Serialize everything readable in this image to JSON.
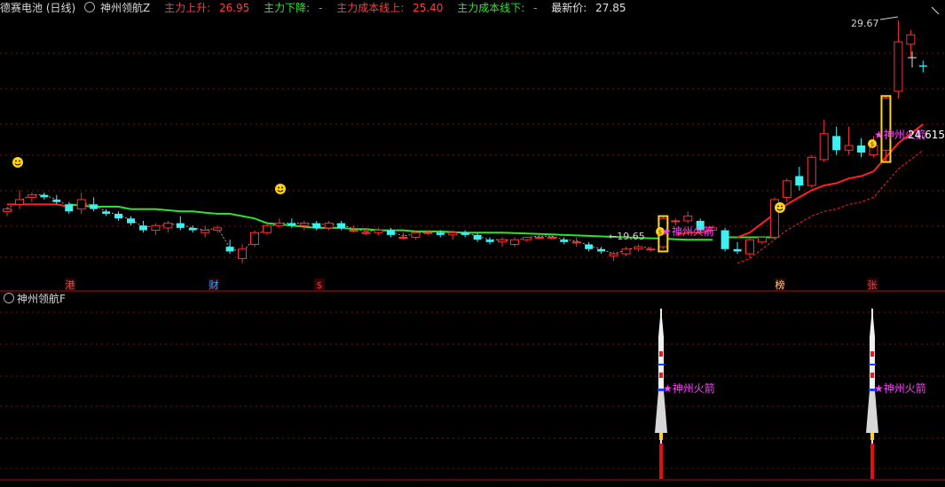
{
  "header": {
    "stock_name": "德赛电池 (日线)",
    "indicator_name": "神州领航Z",
    "up_label": "主力上升:",
    "up_value": "26.95",
    "down_label": "主力下降:",
    "down_value": "-",
    "cost_up_label": "主力成本线上:",
    "cost_up_value": "25.40",
    "cost_down_label": "主力成本线下:",
    "cost_down_value": "-",
    "latest_label": "最新价:",
    "latest_value": "27.85"
  },
  "sub_panel": {
    "title": "神州领航F"
  },
  "markers": {
    "high_label": "29.67",
    "low_label": "19.65",
    "signal_label": "神州火箭",
    "right_value": "24.615"
  },
  "event_tags": [
    "港",
    "财",
    "$",
    "榜",
    "张"
  ],
  "colors": {
    "up": "#ff3030",
    "down": "#3ef0f0",
    "support_green": "#2fe02f",
    "cost_red": "#ff2020",
    "signal_magenta": "#ff40ff",
    "gold": "#ffd21a",
    "background": "#000000"
  },
  "chart_data": {
    "type": "candlestick",
    "title": "德赛电池 (日线)",
    "candles": [
      [
        21.7,
        21.9,
        21.5,
        21.8
      ],
      [
        22.0,
        22.6,
        21.8,
        22.2
      ],
      [
        22.3,
        22.5,
        22.1,
        22.4
      ],
      [
        22.4,
        22.5,
        22.2,
        22.3
      ],
      [
        22.2,
        22.4,
        22.0,
        22.1
      ],
      [
        22.0,
        22.1,
        21.6,
        21.7
      ],
      [
        21.8,
        22.5,
        21.6,
        22.2
      ],
      [
        22.0,
        22.3,
        21.7,
        21.8
      ],
      [
        21.7,
        21.8,
        21.5,
        21.6
      ],
      [
        21.6,
        21.7,
        21.3,
        21.4
      ],
      [
        21.4,
        21.5,
        21.1,
        21.2
      ],
      [
        21.1,
        21.3,
        20.8,
        20.9
      ],
      [
        20.9,
        21.2,
        20.7,
        21.1
      ],
      [
        21.0,
        21.3,
        20.8,
        21.2
      ],
      [
        21.2,
        21.5,
        20.9,
        21.0
      ],
      [
        21.0,
        21.1,
        20.8,
        20.9
      ],
      [
        20.8,
        21.1,
        20.6,
        20.9
      ],
      [
        20.9,
        21.1,
        20.8,
        21.0
      ],
      [
        20.2,
        20.5,
        19.9,
        20.0
      ],
      [
        19.7,
        20.3,
        19.5,
        20.1
      ],
      [
        20.3,
        20.9,
        20.2,
        20.8
      ],
      [
        20.8,
        21.2,
        20.7,
        21.1
      ],
      [
        21.1,
        21.4,
        21.0,
        21.2
      ],
      [
        21.2,
        21.4,
        21.0,
        21.1
      ],
      [
        21.1,
        21.3,
        20.9,
        21.2
      ],
      [
        21.2,
        21.3,
        20.9,
        21.0
      ],
      [
        21.0,
        21.3,
        20.9,
        21.2
      ],
      [
        21.2,
        21.3,
        20.9,
        21.0
      ],
      [
        20.9,
        21.1,
        20.8,
        20.9
      ],
      [
        20.8,
        21.0,
        20.7,
        20.8
      ],
      [
        20.8,
        21.0,
        20.7,
        20.9
      ],
      [
        20.9,
        21.0,
        20.6,
        20.7
      ],
      [
        20.6,
        20.8,
        20.5,
        20.6
      ],
      [
        20.6,
        20.9,
        20.5,
        20.8
      ],
      [
        20.8,
        20.9,
        20.7,
        20.8
      ],
      [
        20.8,
        20.9,
        20.6,
        20.7
      ],
      [
        20.7,
        20.9,
        20.5,
        20.8
      ],
      [
        20.8,
        20.9,
        20.6,
        20.7
      ],
      [
        20.7,
        20.8,
        20.4,
        20.5
      ],
      [
        20.5,
        20.6,
        20.3,
        20.4
      ],
      [
        20.4,
        20.6,
        20.2,
        20.5
      ],
      [
        20.3,
        20.6,
        20.2,
        20.5
      ],
      [
        20.5,
        20.6,
        20.4,
        20.6
      ],
      [
        20.6,
        20.7,
        20.5,
        20.6
      ],
      [
        20.6,
        20.7,
        20.5,
        20.6
      ],
      [
        20.5,
        20.6,
        20.3,
        20.4
      ],
      [
        20.4,
        20.6,
        20.2,
        20.4
      ],
      [
        20.3,
        20.4,
        20.0,
        20.1
      ],
      [
        20.1,
        20.2,
        19.9,
        20.0
      ],
      [
        19.8,
        20.0,
        19.6,
        19.9
      ],
      [
        19.9,
        20.2,
        19.8,
        20.1
      ],
      [
        20.1,
        20.3,
        20.0,
        20.2
      ],
      [
        20.1,
        20.2,
        20.0,
        20.1
      ],
      [
        20.2,
        21.5,
        20.1,
        21.4
      ],
      [
        21.3,
        21.4,
        21.1,
        21.3
      ],
      [
        21.3,
        21.7,
        21.2,
        21.5
      ],
      [
        21.3,
        21.4,
        20.8,
        20.9
      ],
      [
        20.9,
        21.1,
        20.7,
        21.0
      ],
      [
        20.9,
        21.0,
        20.0,
        20.1
      ],
      [
        20.1,
        20.4,
        19.9,
        20.0
      ],
      [
        19.9,
        20.6,
        19.7,
        20.5
      ],
      [
        20.4,
        20.6,
        20.3,
        20.6
      ],
      [
        20.6,
        22.3,
        20.5,
        22.2
      ],
      [
        22.3,
        23.1,
        22.1,
        23.0
      ],
      [
        23.2,
        23.6,
        22.6,
        22.8
      ],
      [
        22.8,
        24.1,
        22.7,
        24.0
      ],
      [
        23.9,
        25.6,
        23.8,
        25.0
      ],
      [
        24.9,
        25.3,
        24.1,
        24.3
      ],
      [
        24.3,
        25.3,
        24.1,
        24.5
      ],
      [
        24.5,
        24.8,
        24.0,
        24.2
      ],
      [
        24.1,
        24.9,
        24.0,
        24.5
      ],
      [
        24.3,
        26.6,
        23.8,
        26.5
      ],
      [
        26.8,
        29.8,
        26.5,
        28.9
      ],
      [
        28.8,
        29.4,
        28.2,
        29.2
      ],
      [
        27.9,
        28.1,
        27.6,
        27.85
      ]
    ],
    "green_line": [
      22.0,
      21.95,
      21.9,
      21.9,
      21.9,
      21.8,
      21.8,
      21.8,
      21.75,
      21.7,
      21.7,
      21.65,
      21.6,
      21.6,
      21.5,
      21.4,
      21.2,
      21.15,
      21.1,
      21.05,
      21.0,
      21.0,
      21.0,
      20.95,
      20.95,
      20.9,
      20.9,
      20.9,
      20.85,
      20.85,
      20.85,
      20.82,
      20.8,
      20.8,
      20.8,
      20.8,
      20.78,
      20.76,
      20.74,
      20.72,
      20.7,
      20.68,
      20.66,
      20.64,
      20.62,
      20.6,
      20.58,
      20.56,
      20.55,
      20.52,
      20.5,
      20.5,
      20.5
    ],
    "green_line_segment2": [
      20.6,
      20.6,
      20.6,
      20.6,
      20.6
    ],
    "red_cost_line": [
      22.0,
      22.0,
      22.0,
      22.0,
      22.0,
      21.9
    ],
    "red_cost_segment2": [
      20.7,
      20.8,
      20.8,
      20.9
    ],
    "red_cost_segment3": [
      20.6,
      20.8,
      21.2,
      21.6,
      22.0,
      22.3,
      22.6,
      22.8,
      22.9,
      23.1,
      23.2,
      23.4,
      24.0,
      24.6,
      25.0,
      25.4
    ],
    "y_range": [
      19.0,
      30.0
    ],
    "high_point": 29.67,
    "low_point": 19.65
  }
}
